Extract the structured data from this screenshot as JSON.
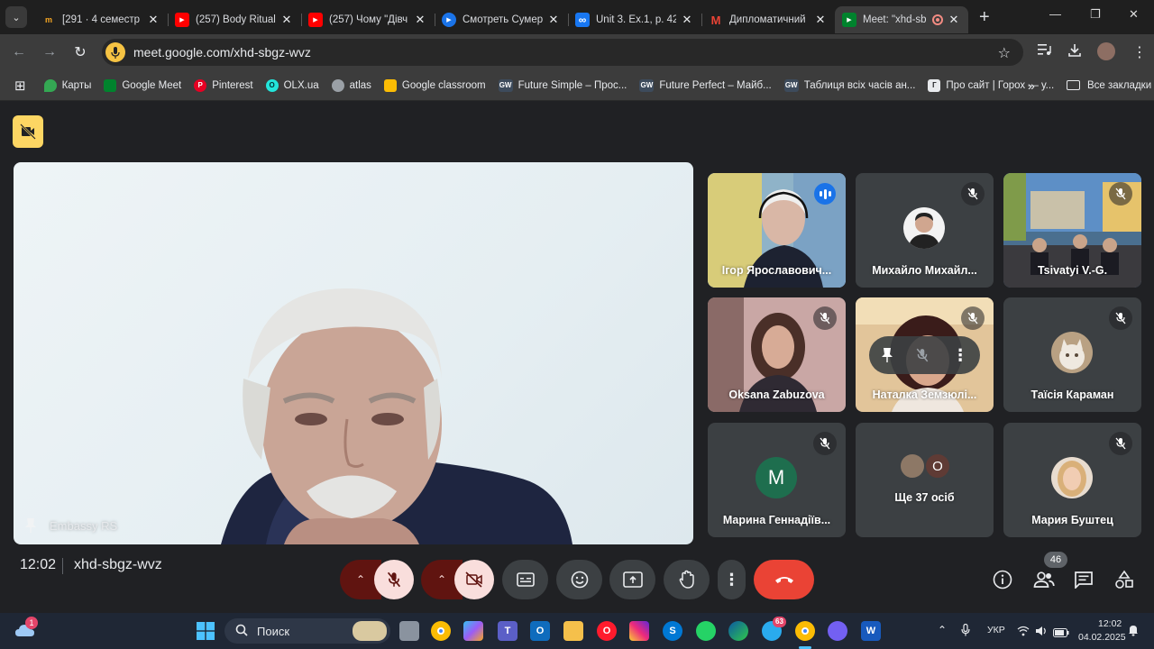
{
  "browser": {
    "tabs": [
      {
        "title": "[291 · 4 семестр 2",
        "color": "#f6a623",
        "glyph": "m"
      },
      {
        "title": "(257) Body Rituals",
        "color": "#ff0000",
        "glyph": "▶"
      },
      {
        "title": "(257) Чому \"Дівч",
        "color": "#ff0000",
        "glyph": "▶"
      },
      {
        "title": "Смотреть Сумерк",
        "color": "#1a73e8",
        "glyph": "▶"
      },
      {
        "title": "Unit 3. Ex.1, p. 42",
        "color": "#1877f2",
        "glyph": "∞"
      },
      {
        "title": "Дипломатичний",
        "color": "#ea4335",
        "glyph": "M"
      },
      {
        "title": "Meet: \"xhd-sb",
        "color": "#00832d",
        "glyph": "▶"
      }
    ],
    "new_tab": "+",
    "url": "meet.google.com/xhd-sbgz-wvz",
    "bookmarks": [
      {
        "label": "Карты",
        "color": "#34a853"
      },
      {
        "label": "Google Meet",
        "color": "#00832d"
      },
      {
        "label": "Pinterest",
        "color": "#e60023"
      },
      {
        "label": "OLX.ua",
        "color": "#23e5db"
      },
      {
        "label": "atlas",
        "color": "#5f6368"
      },
      {
        "label": "Google classroom",
        "color": "#fbbc04"
      },
      {
        "label": "Future Simple – Прос...",
        "color": "#3d4b5c",
        "glyph": "GW"
      },
      {
        "label": "Future Perfect – Майб...",
        "color": "#3d4b5c",
        "glyph": "GW"
      },
      {
        "label": "Таблиця всіх часів ан...",
        "color": "#3d4b5c",
        "glyph": "GW"
      },
      {
        "label": "Про сайт | Горох — у...",
        "color": "#e8eaed",
        "glyph": "Г"
      }
    ],
    "bookmarks_overflow": "»",
    "all_bookmarks": "Все закладки"
  },
  "meet": {
    "main_tile_name": "Embassy RS",
    "participants": [
      {
        "name": "Ігор Ярославович...",
        "speaking": true
      },
      {
        "name": "Михайло Михайл...",
        "muted": true
      },
      {
        "name": "Tsivatyi V.-G.",
        "muted": true
      },
      {
        "name": "Oksana Zabuzova",
        "muted": true
      },
      {
        "name": "Наталка Земзюлі...",
        "muted": true
      },
      {
        "name": "Таїсія Караман",
        "muted": true
      },
      {
        "name": "Марина Геннадіїв...",
        "muted": true,
        "initial": "M"
      },
      {
        "name": "Ще 37 осіб",
        "others_initial": "O"
      },
      {
        "name": "Мария Буштец",
        "muted": true
      }
    ],
    "clock": "12:02",
    "meeting_code": "xhd-sbgz-wvz",
    "people_count": "46"
  },
  "taskbar": {
    "search_label": "Поиск",
    "weather_badge": "1",
    "telegram_badge": "63",
    "language": "УКР",
    "time": "12:02",
    "date": "04.02.2025"
  }
}
